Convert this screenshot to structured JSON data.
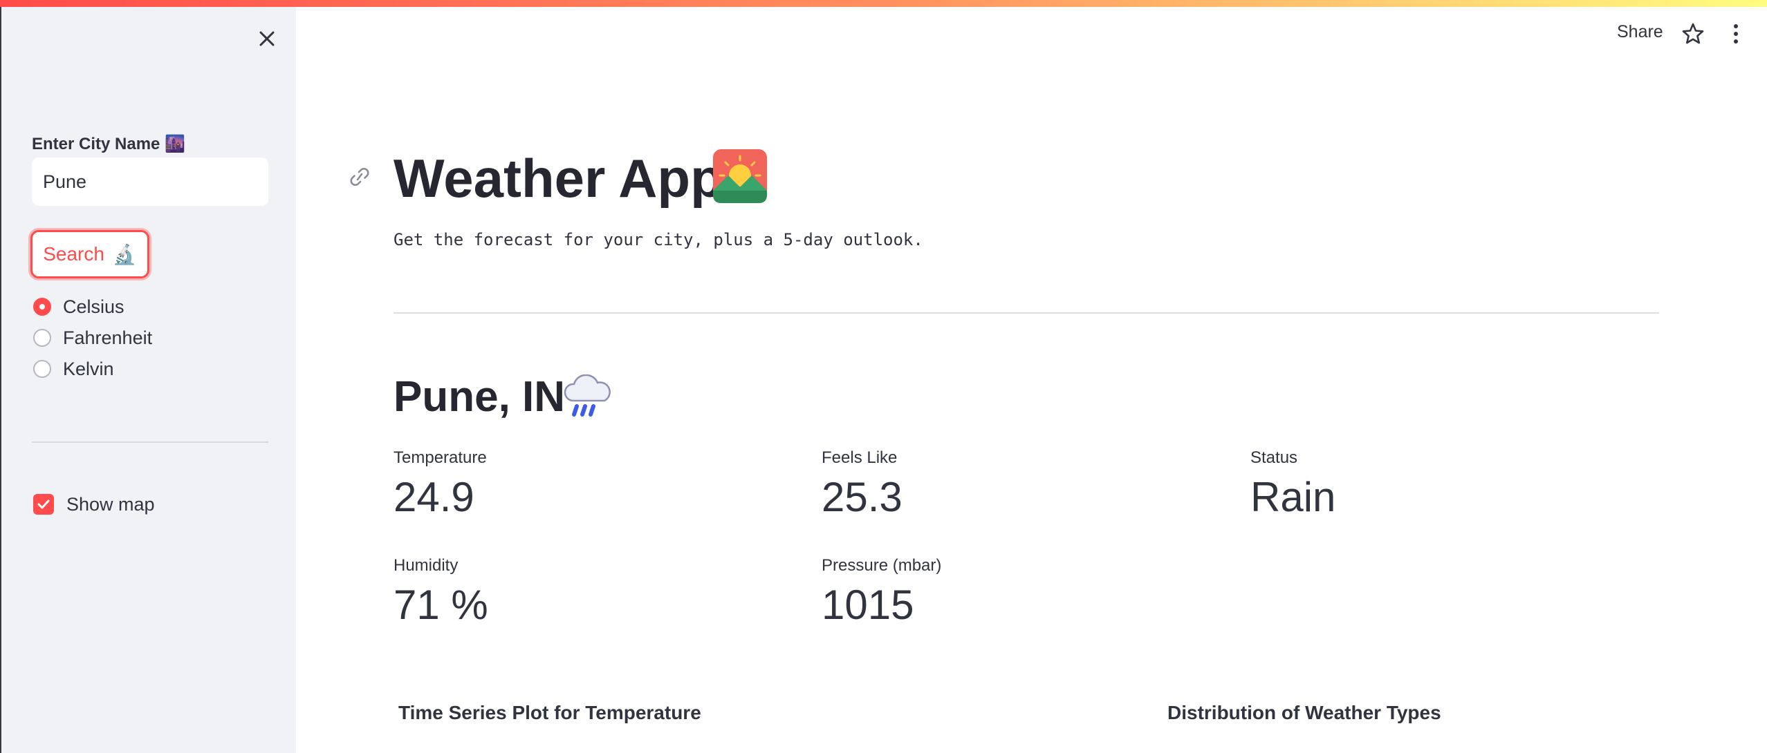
{
  "sidebar": {
    "city_label": "Enter City Name",
    "city_label_emoji": "🌆",
    "city_value": "Pune",
    "search_label": "Search",
    "search_emoji": "🔬",
    "units": [
      {
        "label": "Celsius",
        "selected": true
      },
      {
        "label": "Fahrenheit",
        "selected": false
      },
      {
        "label": "Kelvin",
        "selected": false
      }
    ],
    "show_map_label": "Show map",
    "show_map_checked": true
  },
  "toolbar": {
    "share_label": "Share"
  },
  "main": {
    "title": "Weather App",
    "subtitle": "Get the forecast for your city, plus a 5-day outlook.",
    "city_heading": "Pune, IN",
    "metrics": {
      "temperature": {
        "label": "Temperature",
        "value": "24.9"
      },
      "feels_like": {
        "label": "Feels Like",
        "value": "25.3"
      },
      "status": {
        "label": "Status",
        "value": "Rain"
      },
      "humidity": {
        "label": "Humidity",
        "value": "71 %"
      },
      "pressure": {
        "label": "Pressure (mbar)",
        "value": "1015"
      }
    },
    "time_series_heading": "Time Series Plot for Temperature",
    "distribution_heading": "Distribution of Weather Types"
  },
  "colors": {
    "accent": "#ff4b4b",
    "sidebar_bg": "#f0f2f6",
    "text": "#31333f"
  }
}
